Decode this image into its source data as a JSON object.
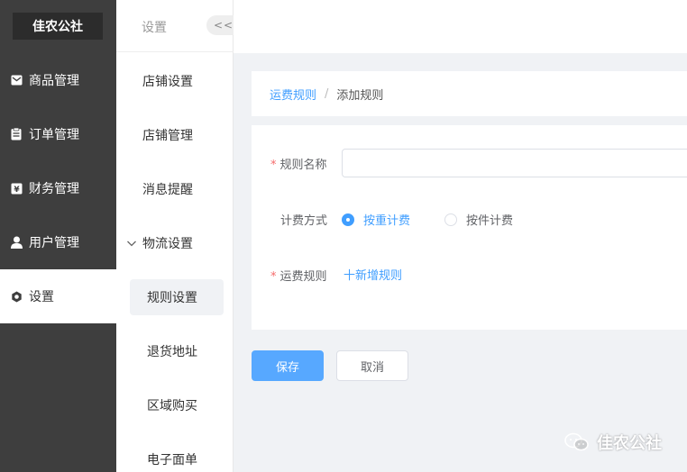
{
  "sidebar": {
    "brand": "佳农公社",
    "items": [
      {
        "label": "商品管理",
        "icon": "envelope-icon"
      },
      {
        "label": "订单管理",
        "icon": "clipboard-icon"
      },
      {
        "label": "财务管理",
        "icon": "yen-icon"
      },
      {
        "label": "用户管理",
        "icon": "user-icon"
      },
      {
        "label": "设置",
        "icon": "gear-icon",
        "active": true
      }
    ]
  },
  "submenu": {
    "title": "设置",
    "collapse": "<<",
    "items": [
      {
        "label": "店铺设置"
      },
      {
        "label": "店铺管理"
      },
      {
        "label": "消息提醒"
      },
      {
        "label": "物流设置",
        "expanded": true
      },
      {
        "label": "规则设置",
        "selected": true
      },
      {
        "label": "退货地址"
      },
      {
        "label": "区域购买"
      },
      {
        "label": "电子面单"
      }
    ]
  },
  "breadcrumb": {
    "parent": "运费规则",
    "separator": "/",
    "current": "添加规则"
  },
  "form": {
    "name_label": "规则名称",
    "name_value": "",
    "billing_label": "计费方式",
    "billing_options": [
      {
        "label": "按重计费",
        "checked": true
      },
      {
        "label": "按件计费",
        "checked": false
      }
    ],
    "rules_label": "运费规则",
    "add_rule": "十新增规则",
    "required_mark": "*"
  },
  "actions": {
    "save": "保存",
    "cancel": "取消"
  },
  "watermark": "佳农公社",
  "colors": {
    "sidebar_bg": "#3e3e3e",
    "accent": "#409eff",
    "primary_button": "#57a8ff",
    "required": "#f56c6c"
  }
}
